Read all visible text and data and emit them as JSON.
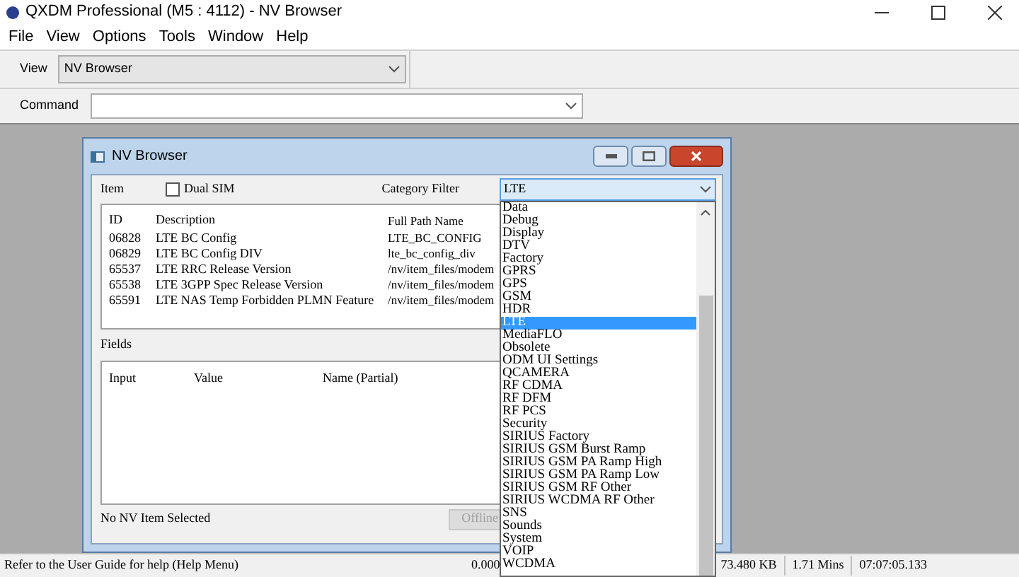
{
  "window": {
    "title": "QXDM Professional (M5 : 4112) - NV Browser"
  },
  "menu": [
    "File",
    "View",
    "Options",
    "Tools",
    "Window",
    "Help"
  ],
  "toolbar": {
    "view_label": "View",
    "view_value": "NV Browser",
    "command_label": "Command"
  },
  "dialog": {
    "title": "NV Browser",
    "item_label": "Item",
    "dual_sim": {
      "label": "Dual SIM",
      "checked": false
    },
    "category_filter": {
      "label": "Category Filter",
      "value": "LTE"
    },
    "items_table": {
      "columns": [
        "ID",
        "Description",
        "Full Path Name"
      ],
      "rows": [
        [
          "06828",
          "LTE BC Config",
          "LTE_BC_CONFIG"
        ],
        [
          "06829",
          "LTE BC Config DIV",
          "lte_bc_config_div"
        ],
        [
          "65537",
          "LTE RRC Release Version",
          "/nv/item_files/modem"
        ],
        [
          "65538",
          "LTE 3GPP Spec Release Version",
          "/nv/item_files/modem"
        ],
        [
          "65591",
          "LTE NAS Temp Forbidden PLMN Feature",
          "/nv/item_files/modem"
        ]
      ]
    },
    "fields_label": "Fields",
    "fields_table": {
      "columns": [
        "Input",
        "Value",
        "Name (Partial)"
      ]
    },
    "status": "No NV Item Selected",
    "offline_button": {
      "label": "Offline",
      "disabled": true
    }
  },
  "category_options": [
    {
      "label": "Data",
      "selected": false
    },
    {
      "label": "Debug",
      "selected": false
    },
    {
      "label": "Display",
      "selected": false
    },
    {
      "label": "DTV",
      "selected": false
    },
    {
      "label": "Factory",
      "selected": false
    },
    {
      "label": "GPRS",
      "selected": false
    },
    {
      "label": "GPS",
      "selected": false
    },
    {
      "label": "GSM",
      "selected": false
    },
    {
      "label": "HDR",
      "selected": false
    },
    {
      "label": "LTE",
      "selected": true
    },
    {
      "label": "MediaFLO",
      "selected": false
    },
    {
      "label": "Obsolete",
      "selected": false
    },
    {
      "label": "ODM UI Settings",
      "selected": false
    },
    {
      "label": "QCAMERA",
      "selected": false
    },
    {
      "label": "RF CDMA",
      "selected": false
    },
    {
      "label": "RF DFM",
      "selected": false
    },
    {
      "label": "RF PCS",
      "selected": false
    },
    {
      "label": "Security",
      "selected": false
    },
    {
      "label": "SIRIUS Factory",
      "selected": false
    },
    {
      "label": "SIRIUS GSM Burst Ramp",
      "selected": false
    },
    {
      "label": "SIRIUS GSM PA Ramp High",
      "selected": false
    },
    {
      "label": "SIRIUS GSM PA Ramp Low",
      "selected": false
    },
    {
      "label": "SIRIUS GSM RF Other",
      "selected": false
    },
    {
      "label": "SIRIUS WCDMA RF Other",
      "selected": false
    },
    {
      "label": "SNS",
      "selected": false
    },
    {
      "label": "Sounds",
      "selected": false
    },
    {
      "label": "System",
      "selected": false
    },
    {
      "label": "VOIP",
      "selected": false
    },
    {
      "label": "WCDMA",
      "selected": false
    }
  ],
  "status_bar": {
    "message": "Refer to the User Guide for help (Help Menu)",
    "value": "0.000",
    "memory": "73.480 KB",
    "elapsed": "1.71 Mins",
    "time": "07:07:05.133"
  }
}
